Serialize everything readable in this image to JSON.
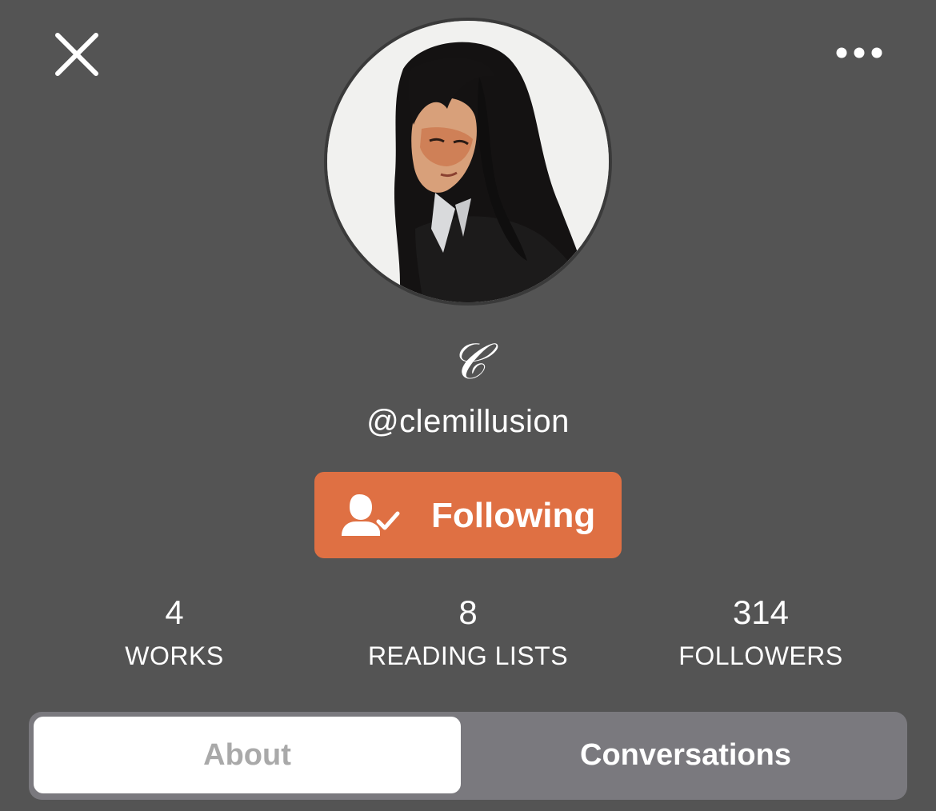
{
  "header": {
    "close_icon": "close-icon",
    "more_icon": "more-horizontal-icon"
  },
  "profile": {
    "avatar_icon": "avatar-photo",
    "display_name": "𝒞",
    "username": "@clemillusion"
  },
  "follow_button": {
    "label": "Following",
    "icon": "user-check-icon",
    "color": "#df7043"
  },
  "stats": [
    {
      "value": "4",
      "label": "WORKS"
    },
    {
      "value": "8",
      "label": "READING LISTS"
    },
    {
      "value": "314",
      "label": "FOLLOWERS"
    }
  ],
  "tabs": [
    {
      "label": "About",
      "selected": true
    },
    {
      "label": "Conversations",
      "selected": false
    }
  ],
  "colors": {
    "background": "#545454",
    "accent": "#df7043",
    "tab_track": "#7a797e"
  }
}
